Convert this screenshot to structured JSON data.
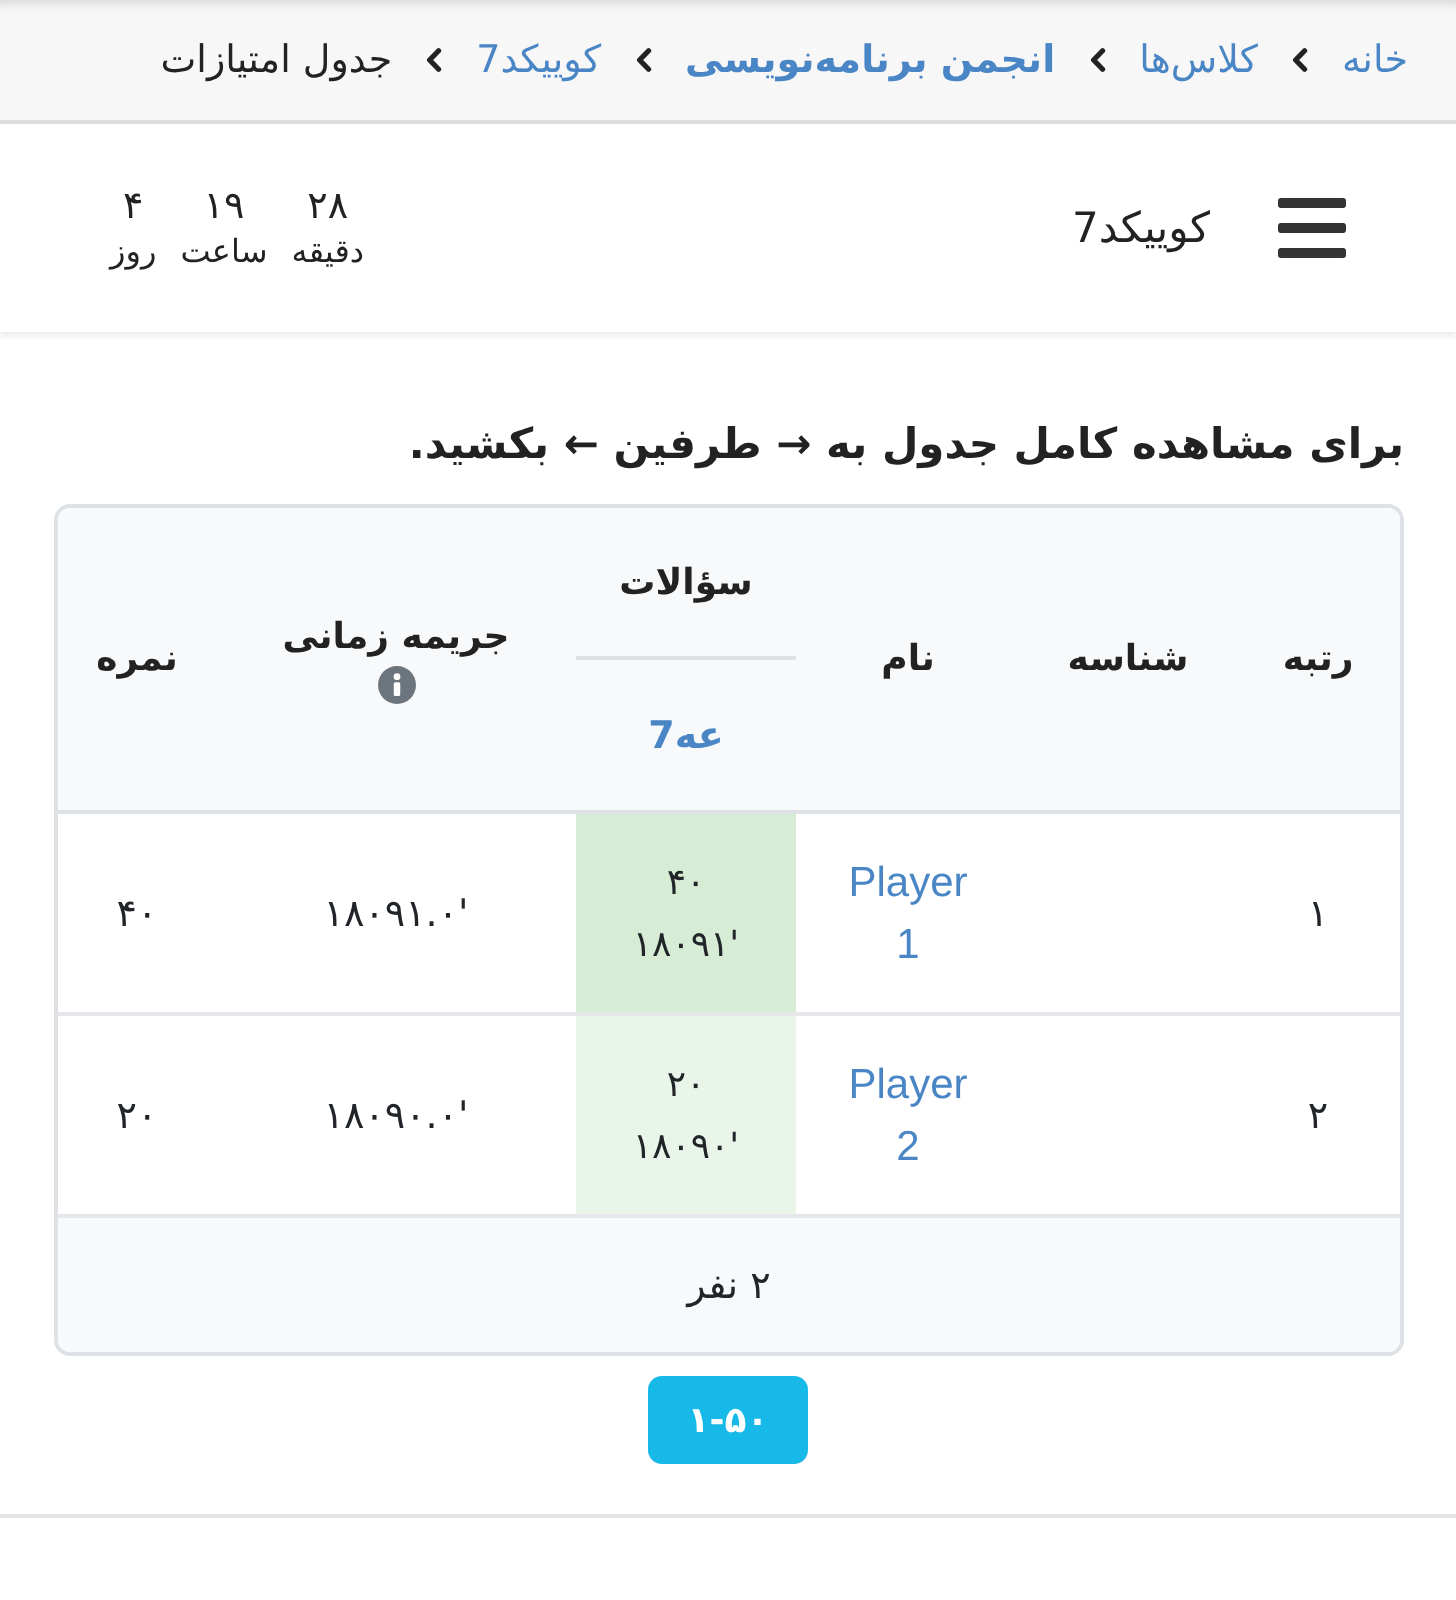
{
  "breadcrumb": [
    {
      "label": "خانه",
      "kind": "link"
    },
    {
      "label": "کلاس‌ها",
      "kind": "link"
    },
    {
      "label": "انجمن برنامه‌نویسی",
      "kind": "strong-link"
    },
    {
      "label": "کوییکد7",
      "kind": "link"
    },
    {
      "label": "جدول امتیازات",
      "kind": "current"
    }
  ],
  "header": {
    "title": "کوییکد7",
    "countdown": [
      {
        "value": "۲۸",
        "unit": "دقیقه"
      },
      {
        "value": "۱۹",
        "unit": "ساعت"
      },
      {
        "value": "۴",
        "unit": "روز"
      }
    ]
  },
  "instruction": "برای مشاهده کامل جدول به → طرفین ← بکشید.",
  "table": {
    "columns": [
      {
        "label": "رتبه"
      },
      {
        "label": "شناسه"
      },
      {
        "label": "نام"
      },
      {
        "label": "سؤالات",
        "problems": [
          "عه7"
        ]
      },
      {
        "label": "جریمه زمانی",
        "info": true
      },
      {
        "label": "نمره"
      }
    ],
    "rows": [
      {
        "rank": "۱",
        "name": "Player 1",
        "problems": [
          {
            "score": "۴۰",
            "time": "۱۸۰۹۱'",
            "first_solve": true
          }
        ],
        "penalty": "۱۸۰۹۱.۰'",
        "score": "۴۰"
      },
      {
        "rank": "۲",
        "name": "Player 2",
        "problems": [
          {
            "score": "۲۰",
            "time": "۱۸۰۹۰'",
            "first_solve": false
          }
        ],
        "penalty": "۱۸۰۹۰.۰'",
        "score": "۲۰"
      }
    ],
    "footer": "۲ نفر"
  },
  "pagination": [
    {
      "label": "۱-۵۰",
      "selected": true
    }
  ]
}
